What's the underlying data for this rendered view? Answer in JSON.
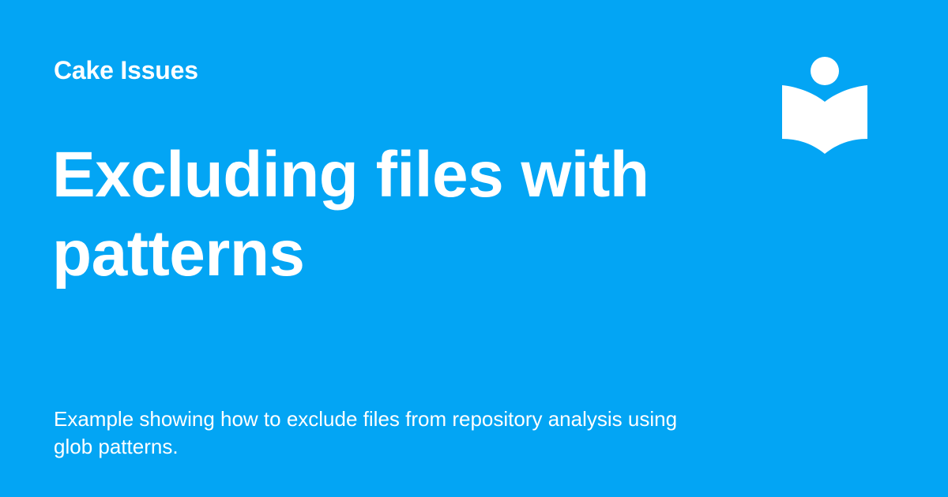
{
  "site": {
    "name": "Cake Issues"
  },
  "page": {
    "title": "Excluding files with patterns",
    "description": "Example showing how to exclude files from repository analysis using glob patterns."
  },
  "logo": {
    "icon": "reader-book-icon"
  },
  "colors": {
    "background": "#03a5f4",
    "foreground": "#ffffff"
  }
}
